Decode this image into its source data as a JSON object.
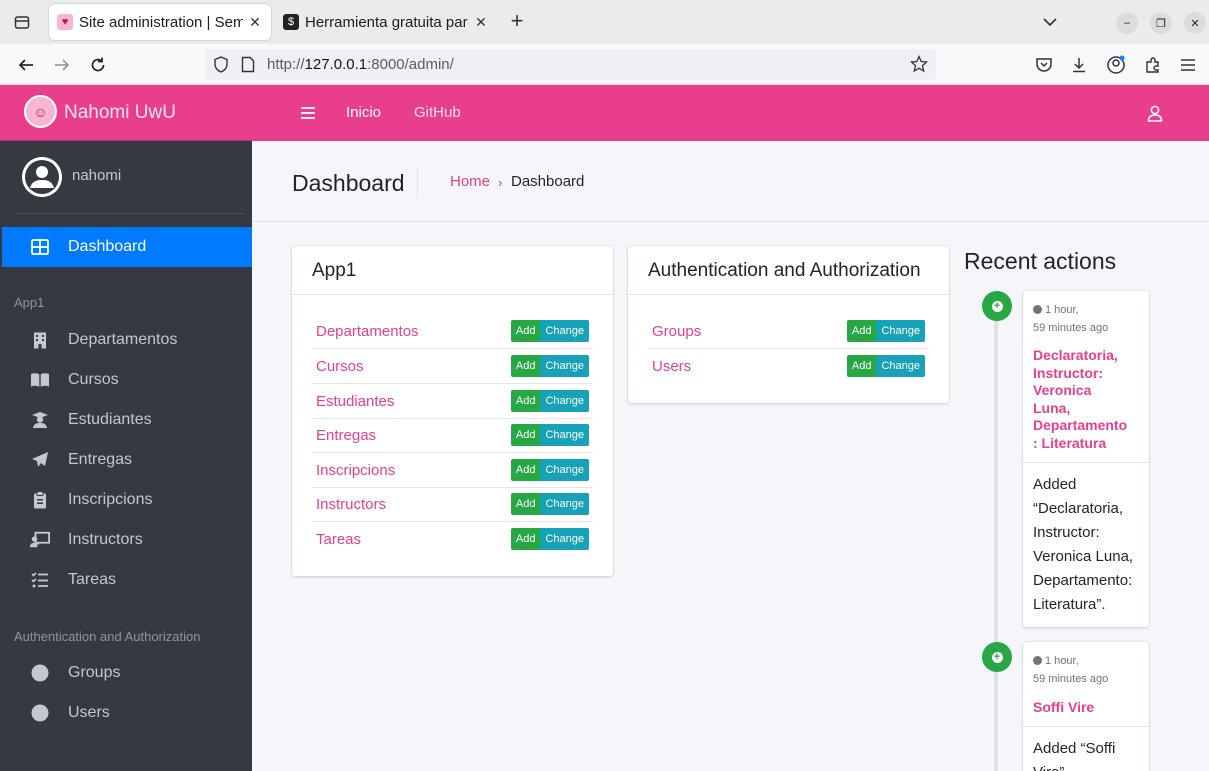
{
  "browser": {
    "tabs": [
      {
        "title": "Site administration | Sem",
        "active": true
      },
      {
        "title": "Herramienta gratuita par",
        "active": false
      }
    ],
    "url_prefix": "http://",
    "url_host": "127.0.0.1",
    "url_path": ":8000/admin/"
  },
  "brand": {
    "name": "Nahomi UwU"
  },
  "topnav": {
    "home": "Inicio",
    "github": "GitHub"
  },
  "user": {
    "name": "nahomi"
  },
  "sidebar": {
    "dashboard": "Dashboard",
    "section1": "App1",
    "items1": [
      "Departamentos",
      "Cursos",
      "Estudiantes",
      "Entregas",
      "Inscripcions",
      "Instructors",
      "Tareas"
    ],
    "section2": "Authentication and Authorization",
    "items2": [
      "Groups",
      "Users"
    ]
  },
  "header": {
    "title": "Dashboard",
    "crumb_home": "Home",
    "crumb_sep": "›",
    "crumb_current": "Dashboard"
  },
  "app1": {
    "title": "App1",
    "models": [
      "Departamentos",
      "Cursos",
      "Estudiantes",
      "Entregas",
      "Inscripcions",
      "Instructors",
      "Tareas"
    ]
  },
  "auth": {
    "title": "Authentication and Authorization",
    "models": [
      "Groups",
      "Users"
    ]
  },
  "buttons": {
    "add": "Add",
    "change": "Change"
  },
  "recent": {
    "title": "Recent actions",
    "items": [
      {
        "time1": "1 hour,",
        "time2": "59 minutes ago",
        "head": [
          "Declaratoria,",
          "Instructor:",
          "Veronica",
          "Luna,",
          "Departamento",
          ": Literatura"
        ],
        "body": [
          "Added",
          "“Declaratoria,",
          "Instructor:",
          "Veronica Luna,",
          "Departamento:",
          "Literatura”."
        ]
      },
      {
        "time1": "1 hour,",
        "time2": "59 minutes ago",
        "head": [
          "Soffi Vire"
        ],
        "body": [
          "Added “Soffi",
          "Vire”."
        ]
      }
    ]
  },
  "colors": {
    "accent": "#e83e8c",
    "active": "#007bff",
    "sidebar": "#343a40",
    "add": "#28a745",
    "change": "#17a2b8"
  }
}
